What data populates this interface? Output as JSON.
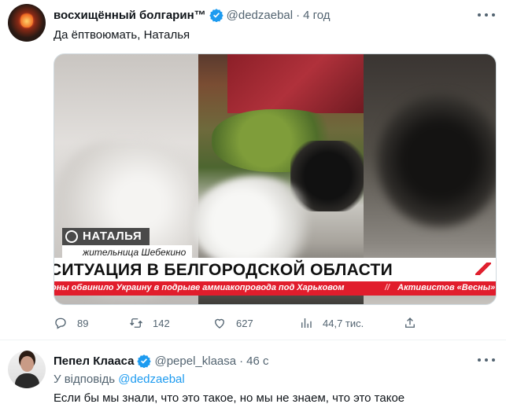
{
  "tweet": {
    "author_name": "восхищённый болгарин™",
    "handle": "@dedzaebal",
    "separator": "·",
    "time": "4 год",
    "text": "Да ёптвоюмать, Наталья",
    "media": {
      "lower_third_name": "НАТАЛЬЯ",
      "lower_third_role": "жительница Шебекино",
      "headline": "СИТУАЦИЯ В БЕЛГОРОДСКОЙ ОБЛАСТИ",
      "ticker_left": "оны обвинило Украину в подрыве аммиакопровода под Харьковом",
      "ticker_right": "Активистов «Весны» зад"
    },
    "stats": {
      "replies": "89",
      "retweets": "142",
      "likes": "627",
      "views": "44,7 тис."
    },
    "icons": [
      "reply-icon",
      "retweet-icon",
      "like-icon",
      "views-icon",
      "share-icon"
    ]
  },
  "reply": {
    "author_name": "Пепел Клааса",
    "handle": "@pepel_klaasa",
    "separator": "·",
    "time": "46 с",
    "reply_to_prefix": "У відповідь",
    "reply_to_handle": "@dedzaebal",
    "text": "Если бы мы знали, что это такое, но мы не знаем, что это такое"
  },
  "colors": {
    "verified_blue": "#1d9bf0",
    "secondary_text": "#536471",
    "ticker_red": "#e11d2c"
  }
}
